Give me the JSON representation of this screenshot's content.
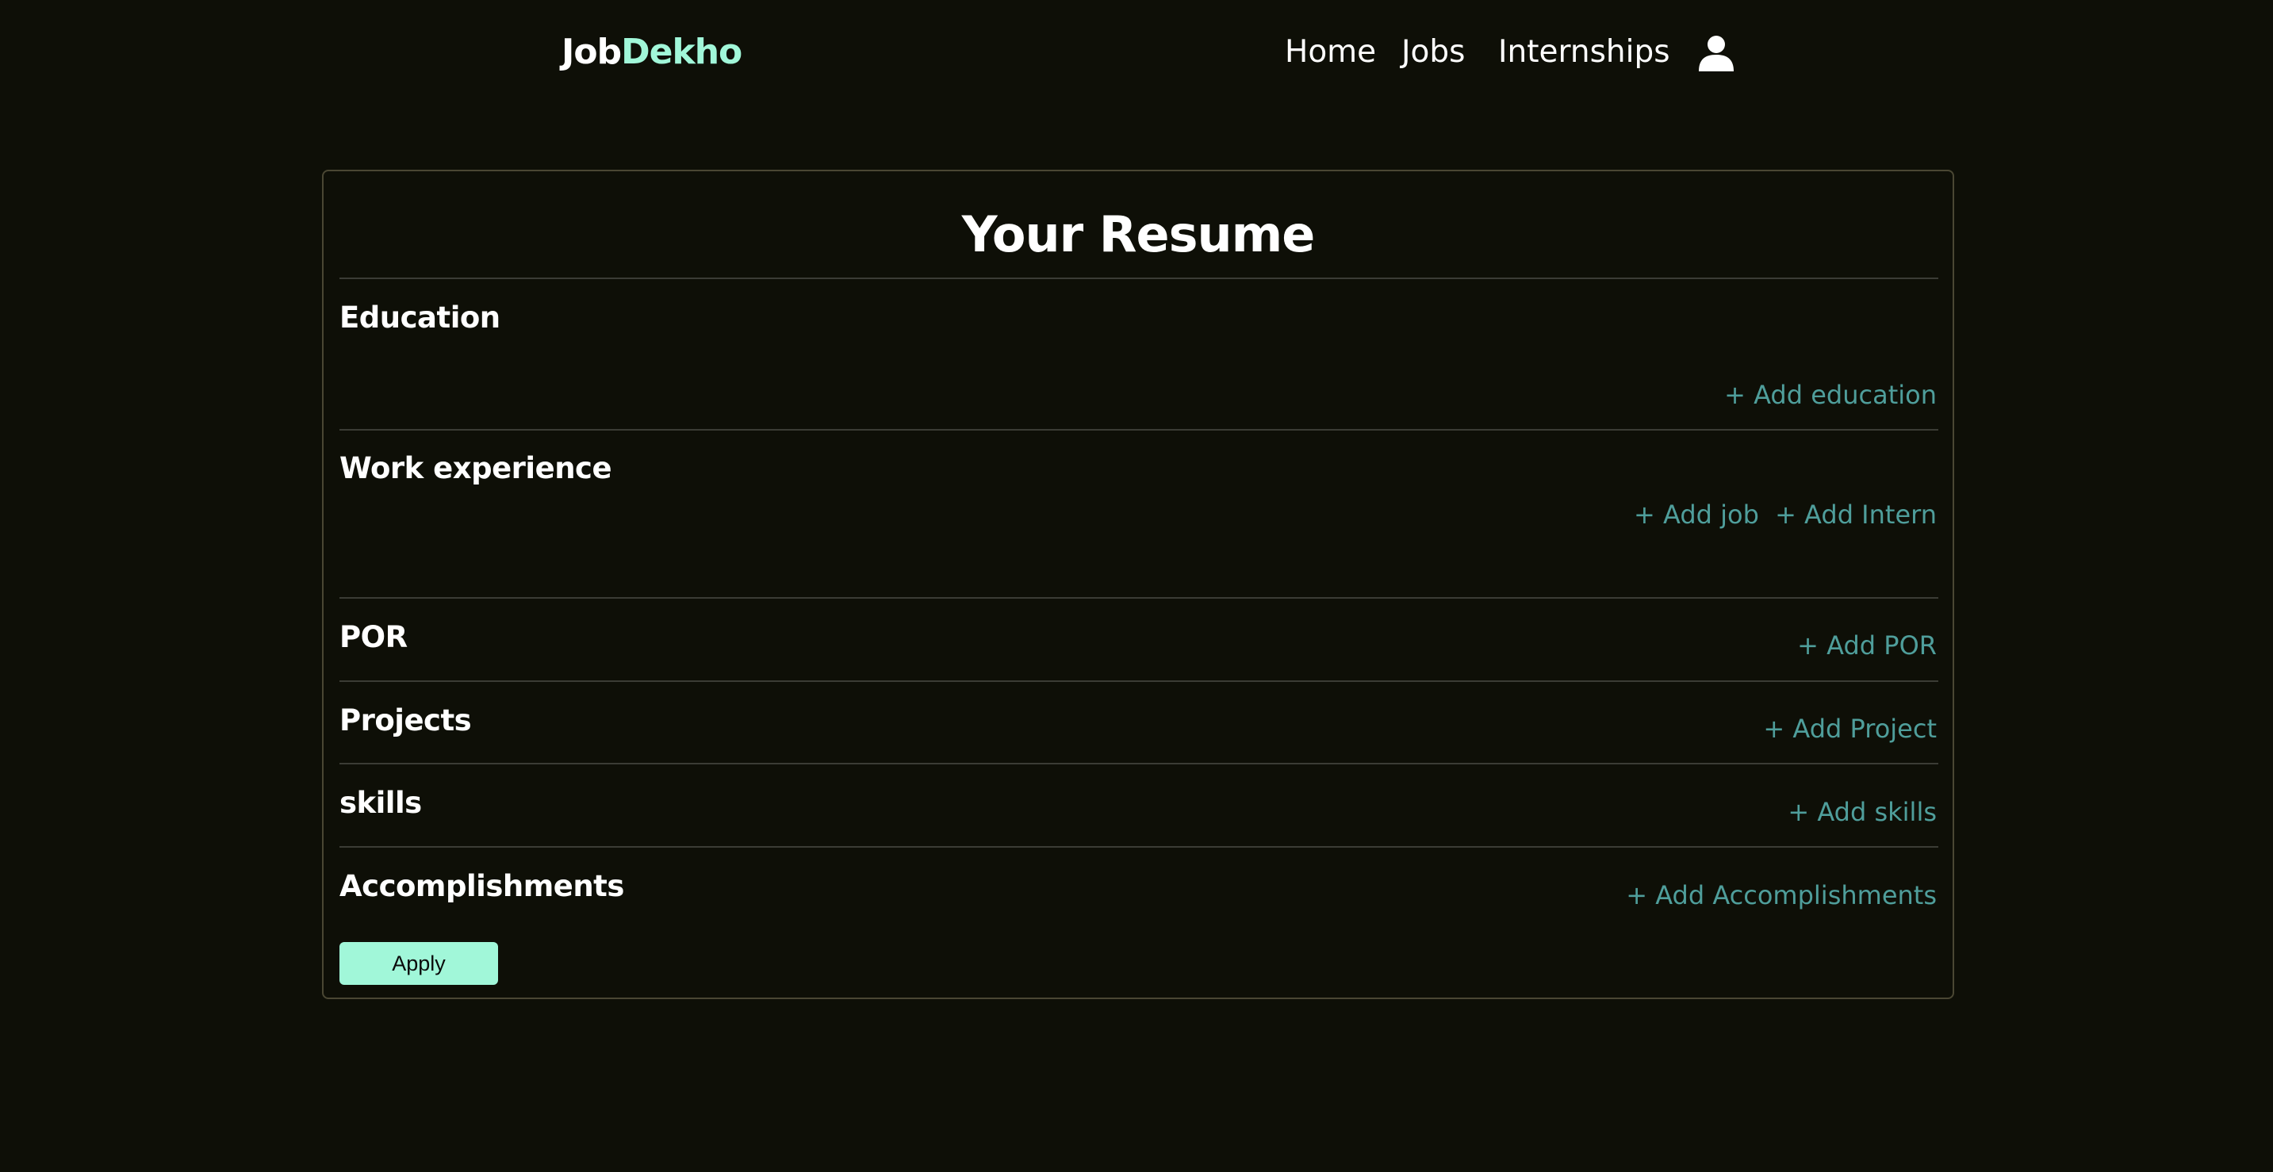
{
  "header": {
    "logo_part1": "Job",
    "logo_part2": "Dekho",
    "nav": {
      "home": "Home",
      "jobs": "Jobs",
      "internships": "Internships"
    },
    "user_icon": "user-icon"
  },
  "resume": {
    "title": "Your Resume",
    "sections": {
      "education": {
        "title": "Education",
        "add": "+ Add education"
      },
      "work": {
        "title": "Work experience",
        "add_job": "+ Add job",
        "add_intern": "+ Add Intern"
      },
      "por": {
        "title": "POR",
        "add": "+ Add POR"
      },
      "projects": {
        "title": "Projects",
        "add": "+ Add Project"
      },
      "skills": {
        "title": "skills",
        "add": "+ Add skills"
      },
      "accomplishments": {
        "title": "Accomplishments",
        "add": "+ Add Accomplishments"
      }
    },
    "apply_label": "Apply"
  },
  "colors": {
    "background": "#0e0f07",
    "accent": "#a1f7d9",
    "link": "#4f9e9b",
    "border": "#4a4733"
  }
}
